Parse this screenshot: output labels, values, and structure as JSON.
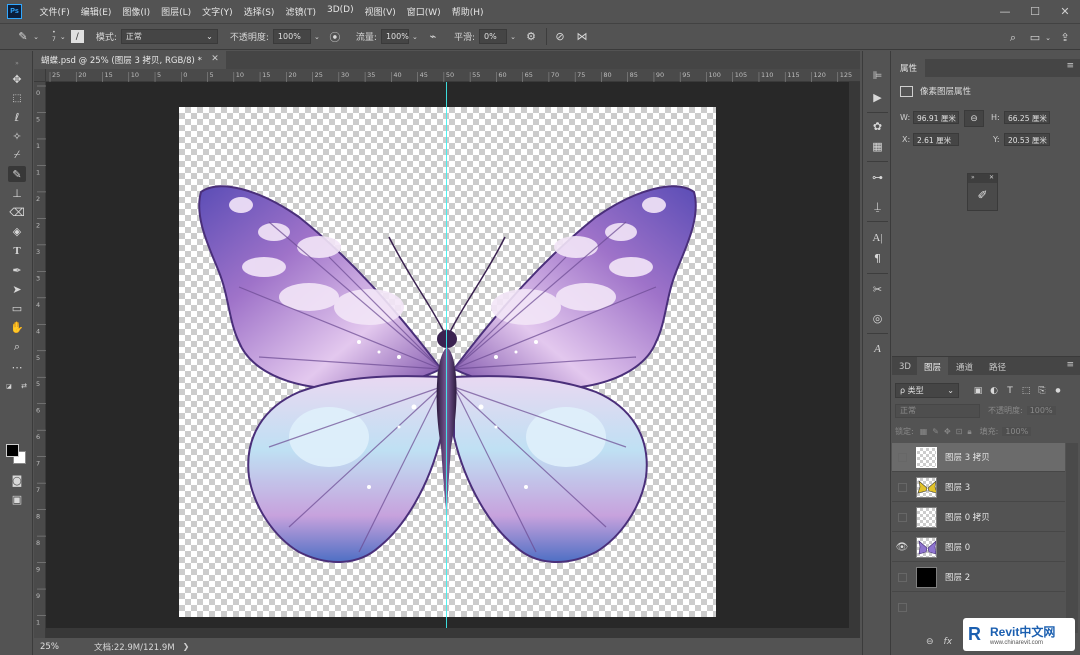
{
  "app": {
    "logo_text": "Ps",
    "menu": [
      "文件(F)",
      "编辑(E)",
      "图像(I)",
      "图层(L)",
      "文字(Y)",
      "选择(S)",
      "滤镜(T)",
      "3D(D)",
      "视图(V)",
      "窗口(W)",
      "帮助(H)"
    ],
    "window_controls": [
      "—",
      "☐",
      "✕"
    ]
  },
  "options": {
    "brush_size": "7",
    "mode_label": "模式:",
    "mode_value": "正常",
    "opacity_label": "不透明度:",
    "opacity_value": "100%",
    "flow_label": "流量:",
    "flow_value": "100%",
    "smoothing_label": "平滑:",
    "smoothing_value": "0%"
  },
  "document": {
    "tab_title": "蝴蝶.psd @ 25% (图层 3 拷贝, RGB/8) *",
    "ruler_h": [
      "25",
      "20",
      "15",
      "10",
      "5",
      "0",
      "5",
      "10",
      "15",
      "20",
      "25",
      "30",
      "35",
      "40",
      "45",
      "50",
      "55",
      "60",
      "65",
      "70",
      "75",
      "80",
      "85",
      "90",
      "95",
      "100",
      "105",
      "110",
      "115",
      "120",
      "125"
    ],
    "ruler_v": [
      "0",
      "5",
      "1",
      "1",
      "2",
      "2",
      "3",
      "3",
      "4",
      "4",
      "5",
      "5",
      "6",
      "6",
      "7",
      "7",
      "8",
      "8",
      "9",
      "9",
      "1"
    ],
    "guide_color": "#3ff0f0"
  },
  "status": {
    "zoom": "25%",
    "doc_info": "文档:22.9M/121.9M"
  },
  "properties": {
    "tab": "属性",
    "title": "像素图层属性",
    "w_label": "W:",
    "w_value": "96.91 厘米",
    "h_label": "H:",
    "h_value": "66.25 厘米",
    "x_label": "X:",
    "x_value": "2.61 厘米",
    "y_label": "Y:",
    "y_value": "20.53 厘米"
  },
  "layers_panel": {
    "tabs": [
      "3D",
      "图层",
      "通道",
      "路径"
    ],
    "active_tab": "图层",
    "filter_label": "ρ 类型",
    "blend_mode": "正常",
    "opacity_label": "不透明度:",
    "opacity_value": "100%",
    "lock_label": "锁定:",
    "fill_label": "填充:",
    "fill_value": "100%",
    "layers": [
      {
        "name": "图层 3 拷贝",
        "visible": false,
        "selected": true
      },
      {
        "name": "图层 3",
        "visible": false,
        "selected": false
      },
      {
        "name": "图层 0 拷贝",
        "visible": false,
        "selected": false
      },
      {
        "name": "图层 0",
        "visible": true,
        "selected": false
      },
      {
        "name": "图层 2",
        "visible": false,
        "selected": false
      }
    ],
    "footer_icons": "fx"
  },
  "watermark": {
    "logo": "R",
    "title": "Revit中文网",
    "url": "www.chinarevit.com"
  },
  "colors": {
    "ui_bg": "#535353",
    "pasteboard": "#282828",
    "butterfly_purple": "#6a4fb8",
    "butterfly_lilac": "#c9a0e0",
    "butterfly_blue": "#a8d4f0"
  }
}
